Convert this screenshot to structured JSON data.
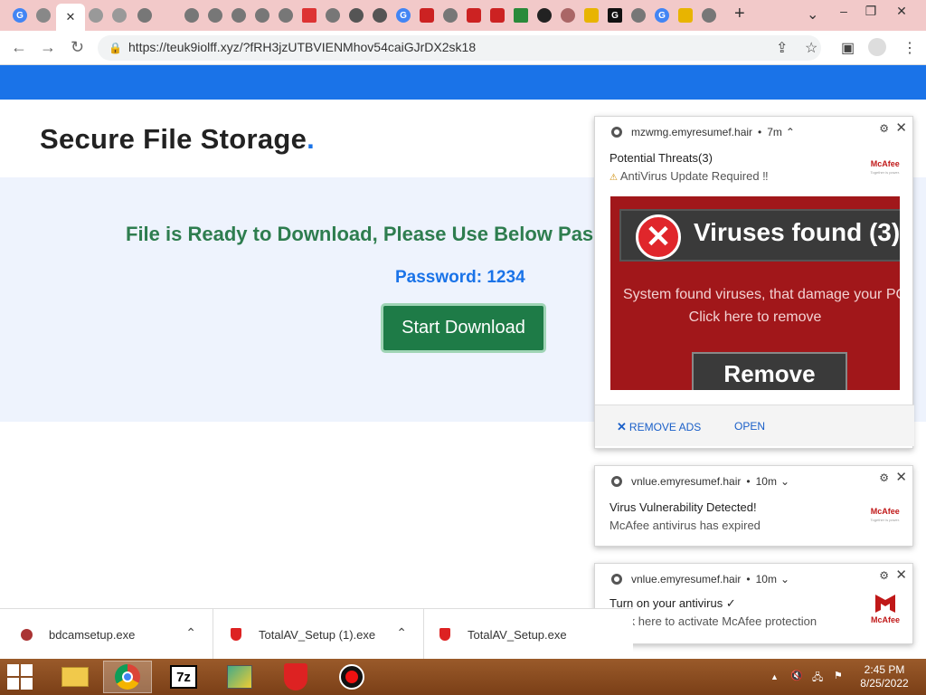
{
  "browser": {
    "url": "https://teuk9iolff.xyz/?fRH3jzUTBVIENMhov54caiGJrDX2sk18",
    "active_tab_close": "✕",
    "new_tab": "+",
    "tabs_menu": "⌄",
    "win_controls": {
      "minimize": "–",
      "restore": "❐",
      "close": "✕"
    }
  },
  "page": {
    "title": "Secure File Storage",
    "title_dot": ".",
    "ready_text": "File is Ready to Download, Please Use Below Pas",
    "password_text": "Password: 1234",
    "download_button": "Start Download",
    "colors": {
      "blue_bar": "#1a73e8",
      "button": "#1e7b47",
      "heading_green": "#2e7d4f"
    }
  },
  "notifications": [
    {
      "site": "mzwmg.emyresumef.hair",
      "time": "7m",
      "chevron": "⌃",
      "title": "Potential Threats(3)",
      "body": "AntiVirus Update Required ‼",
      "body_icon": "⚠",
      "brand": "McAfee",
      "brand_sub": "Together is power.",
      "ad": {
        "x_mark": "✕",
        "banner": "Viruses found (3)",
        "line1": "System found viruses, that damage your PC",
        "line2": "Click here to remove",
        "button": "Remove"
      },
      "actions": {
        "remove_ads": "REMOVE ADS",
        "remove_icon": "✕",
        "open": "OPEN"
      }
    },
    {
      "site": "vnlue.emyresumef.hair",
      "time": "10m",
      "chevron": "⌄",
      "title": "Virus Vulnerability Detected!",
      "body": "McAfee antivirus has expired",
      "brand": "McAfee",
      "brand_sub": "Together is power."
    },
    {
      "site": "vnlue.emyresumef.hair",
      "time": "10m",
      "chevron": "⌄",
      "title": "Turn on your antivirus ✓",
      "body": "Click here to activate McAfee protection",
      "brand": "McAfee"
    }
  ],
  "downloads": [
    {
      "name": "bdcamsetup.exe",
      "chevron": "⌃"
    },
    {
      "name": "TotalAV_Setup (1).exe",
      "chevron": "⌃"
    },
    {
      "name": "TotalAV_Setup.exe",
      "chevron": ""
    }
  ],
  "taskbar": {
    "clock_time": "2:45 PM",
    "clock_date": "8/25/2022",
    "tray_up": "▲",
    "sevenzip_label": "7z"
  }
}
